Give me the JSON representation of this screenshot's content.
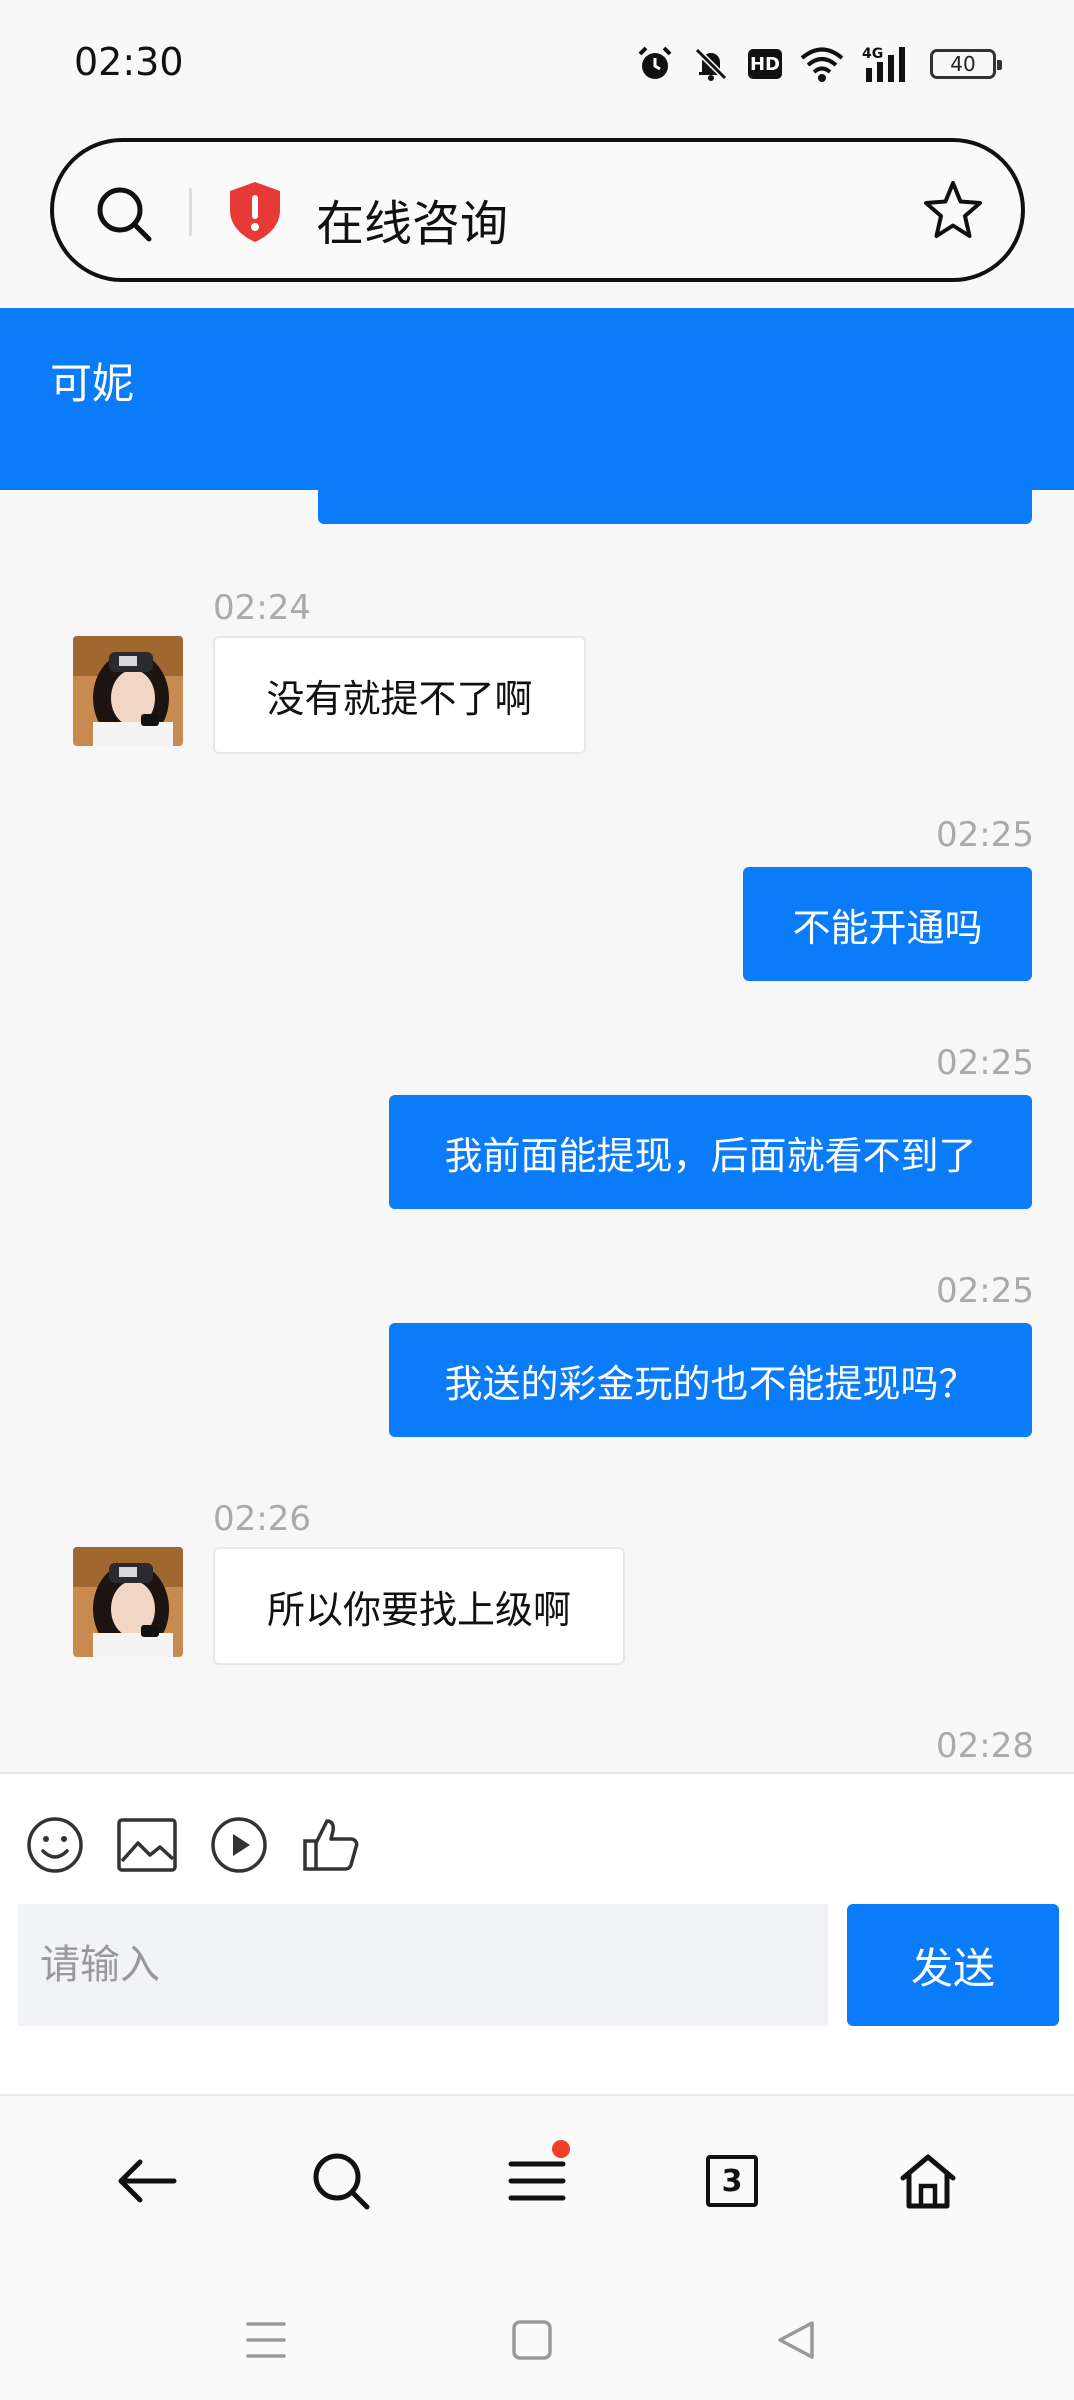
{
  "status_bar": {
    "time": "02:30",
    "battery": "40",
    "network": "4G"
  },
  "address_bar": {
    "title": "在线咨询"
  },
  "chat": {
    "agent_name": "可妮",
    "messages": [
      {
        "direction": "in",
        "time": "02:24",
        "text": "没有就提不了啊"
      },
      {
        "direction": "out",
        "time": "02:25",
        "text": "不能开通吗"
      },
      {
        "direction": "out",
        "time": "02:25",
        "text": "我前面能提现，后面就看不到了"
      },
      {
        "direction": "out",
        "time": "02:25",
        "text": "我送的彩金玩的也不能提现吗？"
      },
      {
        "direction": "in",
        "time": "02:26",
        "text": "所以你要找上级啊"
      },
      {
        "direction": "out",
        "time": "02:28",
        "text": ""
      }
    ]
  },
  "composer": {
    "placeholder": "请输入",
    "send_label": "发送"
  },
  "browser_nav": {
    "tab_count": "3"
  },
  "colors": {
    "accent": "#0a7cf9",
    "notify_dot": "#f0402a"
  }
}
